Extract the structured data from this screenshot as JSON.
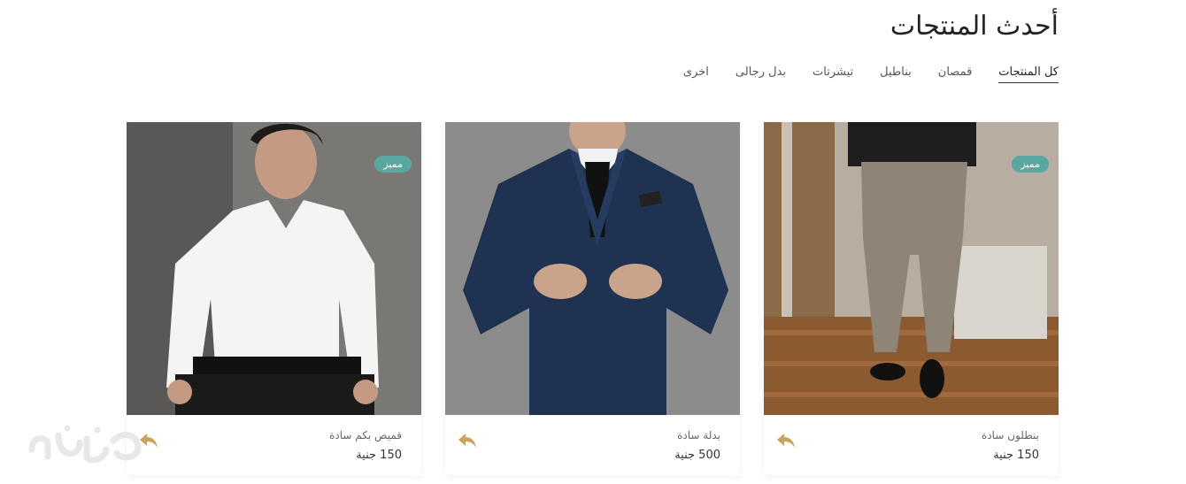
{
  "section": {
    "title": "أحدث المنتجات"
  },
  "filters": [
    {
      "label": "كل المنتجات",
      "active": true
    },
    {
      "label": "قمصان"
    },
    {
      "label": "بناطيل"
    },
    {
      "label": "تيشرتات"
    },
    {
      "label": "بدل رجالى"
    },
    {
      "label": "اخرى"
    }
  ],
  "products": [
    {
      "name": "بنطلون سادة",
      "price": "150 جنية",
      "badge": "مميز",
      "image": "trousers-photo"
    },
    {
      "name": "بدلة سادة",
      "price": "500 جنية",
      "badge": "",
      "image": "suit-photo"
    },
    {
      "name": "قميص بكم سادة",
      "price": "150 جنية",
      "badge": "مميز",
      "image": "shirt-photo"
    }
  ],
  "colors": {
    "badge": "#5aa6a0",
    "share_icon": "#c9a45a"
  },
  "icons": {
    "share": "share-icon"
  },
  "watermark": {
    "text": "نقاش"
  }
}
